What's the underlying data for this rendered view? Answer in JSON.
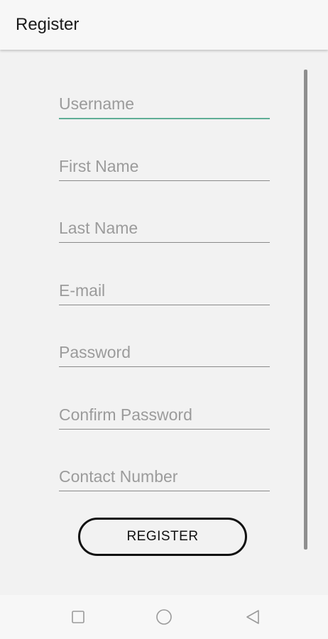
{
  "app_bar": {
    "title": "Register"
  },
  "form": {
    "fields": [
      {
        "placeholder": "Username",
        "value": ""
      },
      {
        "placeholder": "First Name",
        "value": ""
      },
      {
        "placeholder": "Last Name",
        "value": ""
      },
      {
        "placeholder": "E-mail",
        "value": ""
      },
      {
        "placeholder": "Password",
        "value": ""
      },
      {
        "placeholder": "Confirm Password",
        "value": ""
      },
      {
        "placeholder": "Contact Number",
        "value": ""
      }
    ],
    "register_label": "REGISTER"
  },
  "nav_bar": {
    "icons": [
      "square-icon",
      "circle-icon",
      "triangle-back-icon"
    ]
  },
  "colors": {
    "focus_underline": "#5fae95",
    "underline": "#8a8a8a",
    "background": "#f2f2f2"
  }
}
